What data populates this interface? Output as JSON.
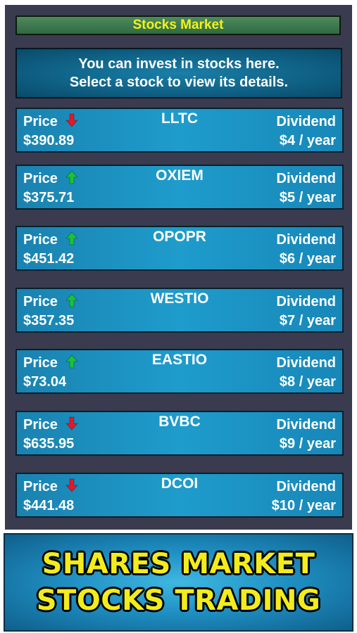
{
  "header": {
    "title": "Stocks Market"
  },
  "info": {
    "line1": "You can invest in stocks here.",
    "line2": "Select a stock to view its details."
  },
  "stocks": [
    {
      "name": "LLTC",
      "price_label": "Price",
      "price": "$390.89",
      "trend": "down",
      "dividend_label": "Dividend",
      "dividend": "$4 / year"
    },
    {
      "name": "OXIEM",
      "price_label": "Price",
      "price": "$375.71",
      "trend": "up",
      "dividend_label": "Dividend",
      "dividend": "$5 / year"
    },
    {
      "name": "OPOPR",
      "price_label": "Price",
      "price": "$451.42",
      "trend": "up",
      "dividend_label": "Dividend",
      "dividend": "$6 / year"
    },
    {
      "name": "WESTIO",
      "price_label": "Price",
      "price": "$357.35",
      "trend": "up",
      "dividend_label": "Dividend",
      "dividend": "$7 / year"
    },
    {
      "name": "EASTIO",
      "price_label": "Price",
      "price": "$73.04",
      "trend": "up",
      "dividend_label": "Dividend",
      "dividend": "$8 / year"
    },
    {
      "name": "BVBC",
      "price_label": "Price",
      "price": "$635.95",
      "trend": "down",
      "dividend_label": "Dividend",
      "dividend": "$9 / year"
    },
    {
      "name": "DCOI",
      "price_label": "Price",
      "price": "$441.48",
      "trend": "down",
      "dividend_label": "Dividend",
      "dividend": "$10 / year"
    }
  ],
  "banner": {
    "line1": "SHARES MARKET",
    "line2": "STOCKS TRADING"
  },
  "colors": {
    "up": "#19c23a",
    "down": "#e3182a",
    "title_text": "#f4f21a"
  },
  "icons": {
    "up": "arrow-up-icon",
    "down": "arrow-down-icon"
  }
}
